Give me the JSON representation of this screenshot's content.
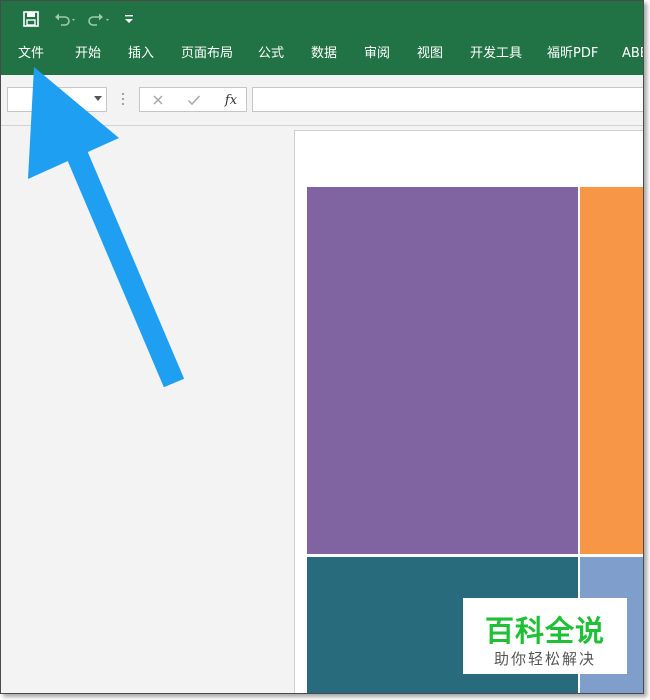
{
  "quick_access": {
    "save_icon": "save-icon",
    "undo_icon": "undo-icon",
    "redo_icon": "redo-icon",
    "customize_icon": "customize-qat-icon"
  },
  "ribbon": {
    "tabs": [
      "文件",
      "开始",
      "插入",
      "页面布局",
      "公式",
      "数据",
      "审阅",
      "视图",
      "开发工具",
      "福昕PDF",
      "ABB"
    ]
  },
  "formula_bar": {
    "name_box_value": "",
    "formula_value": "",
    "fx_label": "fx",
    "cancel_icon": "cancel-icon",
    "enter_icon": "check-icon"
  },
  "treemap": {
    "colors": [
      "#8064a2",
      "#f79646",
      "#276b7c",
      "#7f9ecb"
    ]
  },
  "watermark": {
    "main": "百科全说",
    "sub": "助你轻松解决"
  },
  "annotation": {
    "color": "#1e9ff2"
  },
  "theme": {
    "ribbon_green": "#217346"
  }
}
